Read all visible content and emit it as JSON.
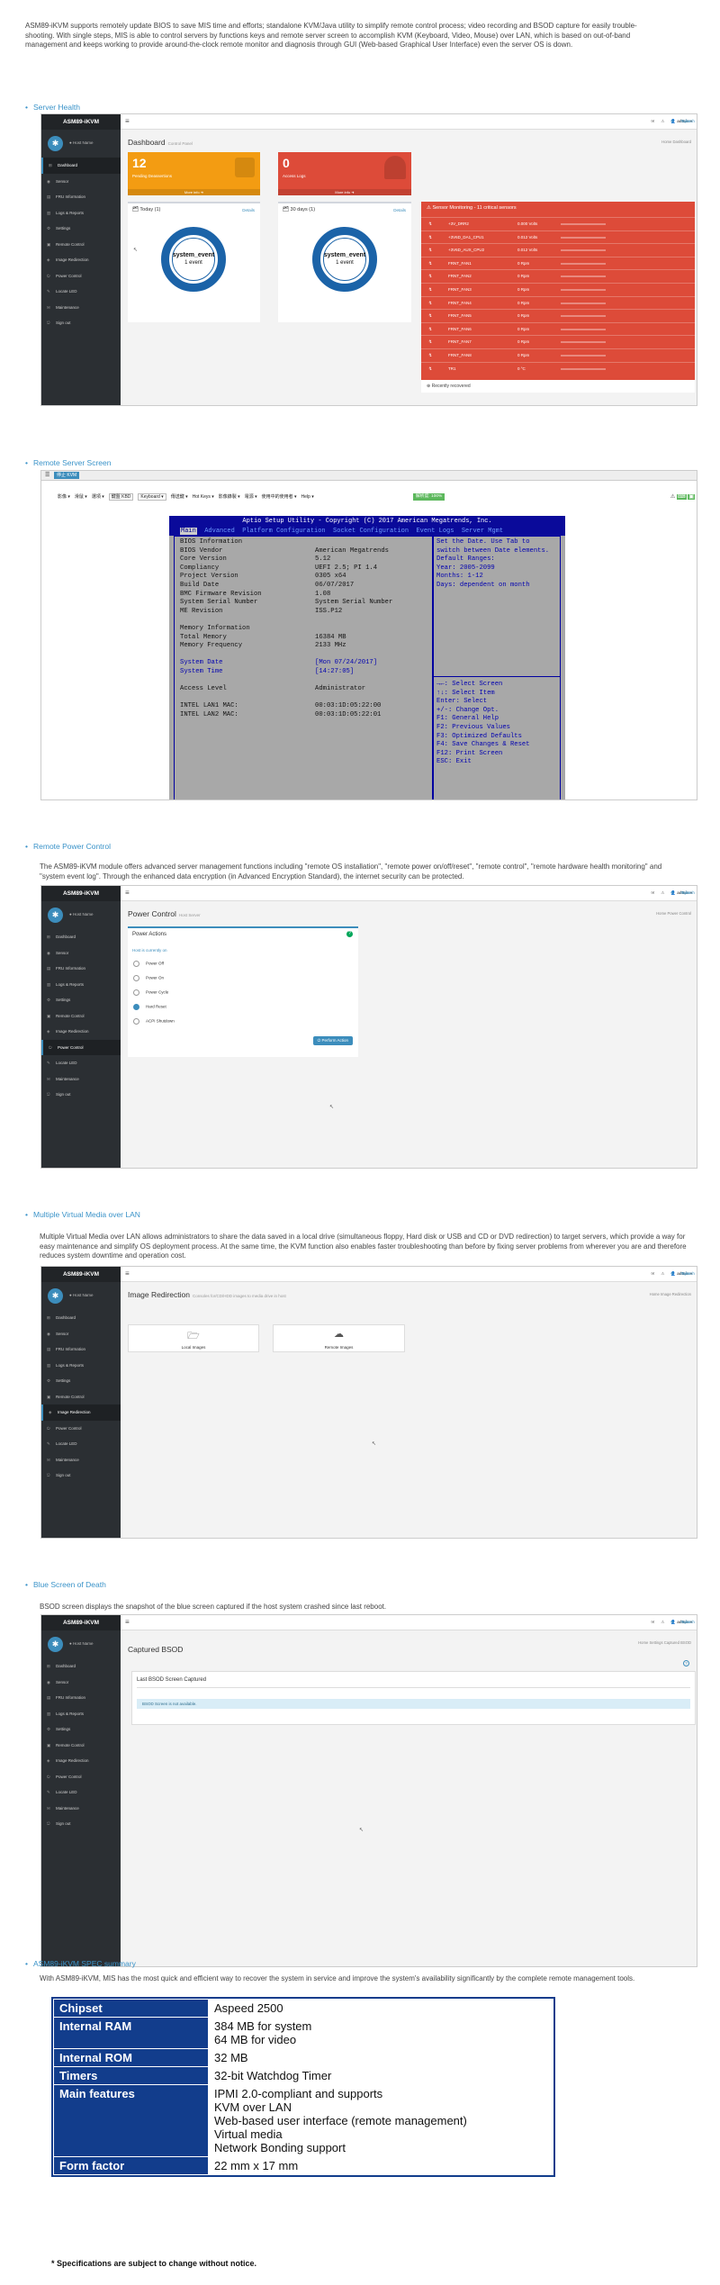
{
  "intro": "ASM89-iKVM supports remotely update BIOS to save MIS time and efforts; standalone KVM/Java utility to simplify remote control process; video recording and BSOD capture for easily trouble-shooting. With single steps, MIS is able to control servers by functions keys and remote server screen to accomplish KVM (Keyboard, Video, Mouse) over LAN, which is based on out-of-band management and keeps working to provide around-the-clock remote monitor and diagnosis through GUI (Web-based Graphical User Interface) even the server OS is down.",
  "common": {
    "brand": "ASM89-iKVM",
    "host": "● Host Name",
    "sync": "Sync",
    "refresh": "Refresh",
    "user": "admin",
    "nav": [
      "Dashboard",
      "Sensor",
      "FRU Information",
      "Logs & Reports",
      "Settings",
      "Remote Control",
      "Image Redirection",
      "Power Control",
      "Locate LED",
      "Maintenance",
      "Sign out"
    ]
  },
  "sections": {
    "health": "Server Health",
    "remote": "Remote Server Screen",
    "power": "Remote Power Control",
    "power_desc": "The ASM89-iKVM module offers advanced server management functions including \"remote OS installation\", \"remote power on/off/reset\", \"remote control\", \"remote hardware health monitoring\" and \"system event log\". Through the enhanced data encryption (in Advanced Encryption Standard), the internet security can be protected.",
    "media": "Multiple Virtual Media over LAN",
    "media_desc": "Multiple Virtual Media over LAN allows administrators to share the data saved in a local drive (simultaneous floppy, Hard disk or USB and CD or DVD redirection) to target servers, which provide a way for easy maintenance and simplify OS deployment process. At the same time, the KVM function also enables faster troubleshooting than before by fixing server problems from wherever you are and therefore reduces system downtime and operation cost.",
    "bsod": "Blue Screen of Death",
    "bsod_desc": "BSOD screen displays the snapshot of the blue screen captured if the host system crashed since last reboot.",
    "spec": "ASM89-iKVM SPEC summary",
    "spec_desc": "With ASM89-iKVM, MIS has the most quick and efficient way to recover the system in service and improve the system's availability significantly by the complete remote management tools."
  },
  "dashboard": {
    "title": "Dashboard",
    "subtitle": "Control Panel",
    "crumb": "Home  Dashboard",
    "tile1_num": "12",
    "tile1_label": "Pending Deassertions",
    "tile2_num": "0",
    "tile2_label": "Access Logs",
    "more": "More info",
    "today": "Today (1)",
    "days30": "30 days (1)",
    "details": "Details",
    "gauge_t1": "system_event",
    "gauge_t2": "1 event",
    "sensor_title": "Sensor Monitoring - 11 critical sensors",
    "sensors": [
      {
        "n": "+3V_DRR2",
        "v": "0.000 Volts"
      },
      {
        "n": "+3V6D_DA1_CPU1",
        "v": "0.012 Volts"
      },
      {
        "n": "+3V6D_AUX_CPU2",
        "v": "0.012 Volts"
      },
      {
        "n": "FRNT_FAN1",
        "v": "0 Rpm"
      },
      {
        "n": "FRNT_FAN2",
        "v": "0 Rpm"
      },
      {
        "n": "FRNT_FAN3",
        "v": "0 Rpm"
      },
      {
        "n": "FRNT_FAN4",
        "v": "0 Rpm"
      },
      {
        "n": "FRNT_FAN5",
        "v": "0 Rpm"
      },
      {
        "n": "FRNT_FAN6",
        "v": "0 Rpm"
      },
      {
        "n": "FRNT_FAN7",
        "v": "0 Rpm"
      },
      {
        "n": "FRNT_FAN8",
        "v": "0 Rpm"
      },
      {
        "n": "TR1",
        "v": "0 °C"
      }
    ],
    "recovered": "Recently recovered"
  },
  "kvm": {
    "stop": "停止 KVM",
    "menu": [
      "影像 ▾",
      "滑鼠 ▾",
      "選項 ▾",
      "鍵盤 KBD",
      "Keyboard ▾",
      "傳送鍵 ▾",
      "Hot Keys ▾",
      "影像錄製 ▾",
      "電源 ▾",
      "使用中的使用者 ▾",
      "Help ▾"
    ],
    "zoom": "解析度: 100%",
    "bios_title": "Aptio Setup Utility - Copyright (C) 2017 American Megatrends, Inc.",
    "bios_tabs": "Main  Advanced  Platform Configuration  Socket Configuration  Event Logs  Server Mgmt",
    "bios_main_label": "Main",
    "rows": [
      {
        "k": "BIOS Information",
        "v": ""
      },
      {
        "k": "BIOS Vendor",
        "v": "American Megatrends"
      },
      {
        "k": "Core Version",
        "v": "5.12"
      },
      {
        "k": "Compliancy",
        "v": "UEFI 2.5; PI 1.4"
      },
      {
        "k": "Project Version",
        "v": "0305 x64"
      },
      {
        "k": "Build Date",
        "v": "06/07/2017"
      },
      {
        "k": "BMC Firmware Revision",
        "v": "1.08"
      },
      {
        "k": "System Serial Number",
        "v": "System Serial Number"
      },
      {
        "k": "ME Revision",
        "v": "ISS.P12"
      },
      {
        "k": "",
        "v": ""
      },
      {
        "k": "Memory Information",
        "v": ""
      },
      {
        "k": "Total Memory",
        "v": "16384 MB"
      },
      {
        "k": "Memory Frequency",
        "v": "2133 MHz"
      },
      {
        "k": "",
        "v": ""
      },
      {
        "k": "System Date",
        "v": "[Mon 07/24/2017]"
      },
      {
        "k": "System Time",
        "v": "[14:27:05]"
      },
      {
        "k": "",
        "v": ""
      },
      {
        "k": "Access Level",
        "v": "Administrator"
      },
      {
        "k": "",
        "v": ""
      },
      {
        "k": "INTEL LAN1 MAC:",
        "v": "00:03:1D:05:22:00"
      },
      {
        "k": "INTEL LAN2 MAC:",
        "v": "00:03:1D:05:22:01"
      }
    ],
    "help": [
      "Set the Date. Use Tab to",
      "switch between Date elements.",
      "Default Ranges:",
      "Year: 2005-2099",
      "Months: 1-12",
      "Days: dependent on month"
    ],
    "keys": [
      "→←: Select Screen",
      "↑↓: Select Item",
      "Enter: Select",
      "+/-: Change Opt.",
      "F1: General Help",
      "F2: Previous Values",
      "F3: Optimized Defaults",
      "F4: Save Changes & Reset",
      "F12: Print Screen",
      "ESC: Exit"
    ]
  },
  "power": {
    "title": "Power Control",
    "subtitle": "Host Server",
    "crumb": "Home  Power Control",
    "box": "Power Actions",
    "status": "Host is currently on",
    "options": [
      "Power Off",
      "Power On",
      "Power Cycle",
      "Hard Reset",
      "ACPI Shutdown"
    ],
    "selected": 3,
    "btn": "Perform Action"
  },
  "image": {
    "title": "Image Redirection",
    "subtitle": "Consoles for/CD/HDD images to media drive in host",
    "crumb": "Home  Image Redirection",
    "local": "Local Images",
    "remote": "Remote Images"
  },
  "bsod": {
    "title": "Captured BSOD",
    "crumb": "Home  Settings  Captured BSOD",
    "box": "Last BSOD Screen Captured",
    "msg": "BSOD Screen is not available."
  },
  "spec": {
    "rows": [
      {
        "k": "Chipset",
        "v": [
          "Aspeed 2500"
        ]
      },
      {
        "k": "Internal RAM",
        "v": [
          "384 MB for system",
          "64 MB for video"
        ]
      },
      {
        "k": "Internal ROM",
        "v": [
          "32 MB"
        ]
      },
      {
        "k": "Timers",
        "v": [
          "32-bit Watchdog Timer"
        ]
      },
      {
        "k": "Main features",
        "v": [
          "IPMI 2.0-compliant and supports",
          "KVM over LAN",
          "Web-based user interface (remote management)",
          "Virtual media",
          "Network Bonding support"
        ]
      },
      {
        "k": "Form factor",
        "v": [
          "22 mm x 17 mm"
        ]
      }
    ],
    "note": "* Specifications are subject to change without notice."
  }
}
